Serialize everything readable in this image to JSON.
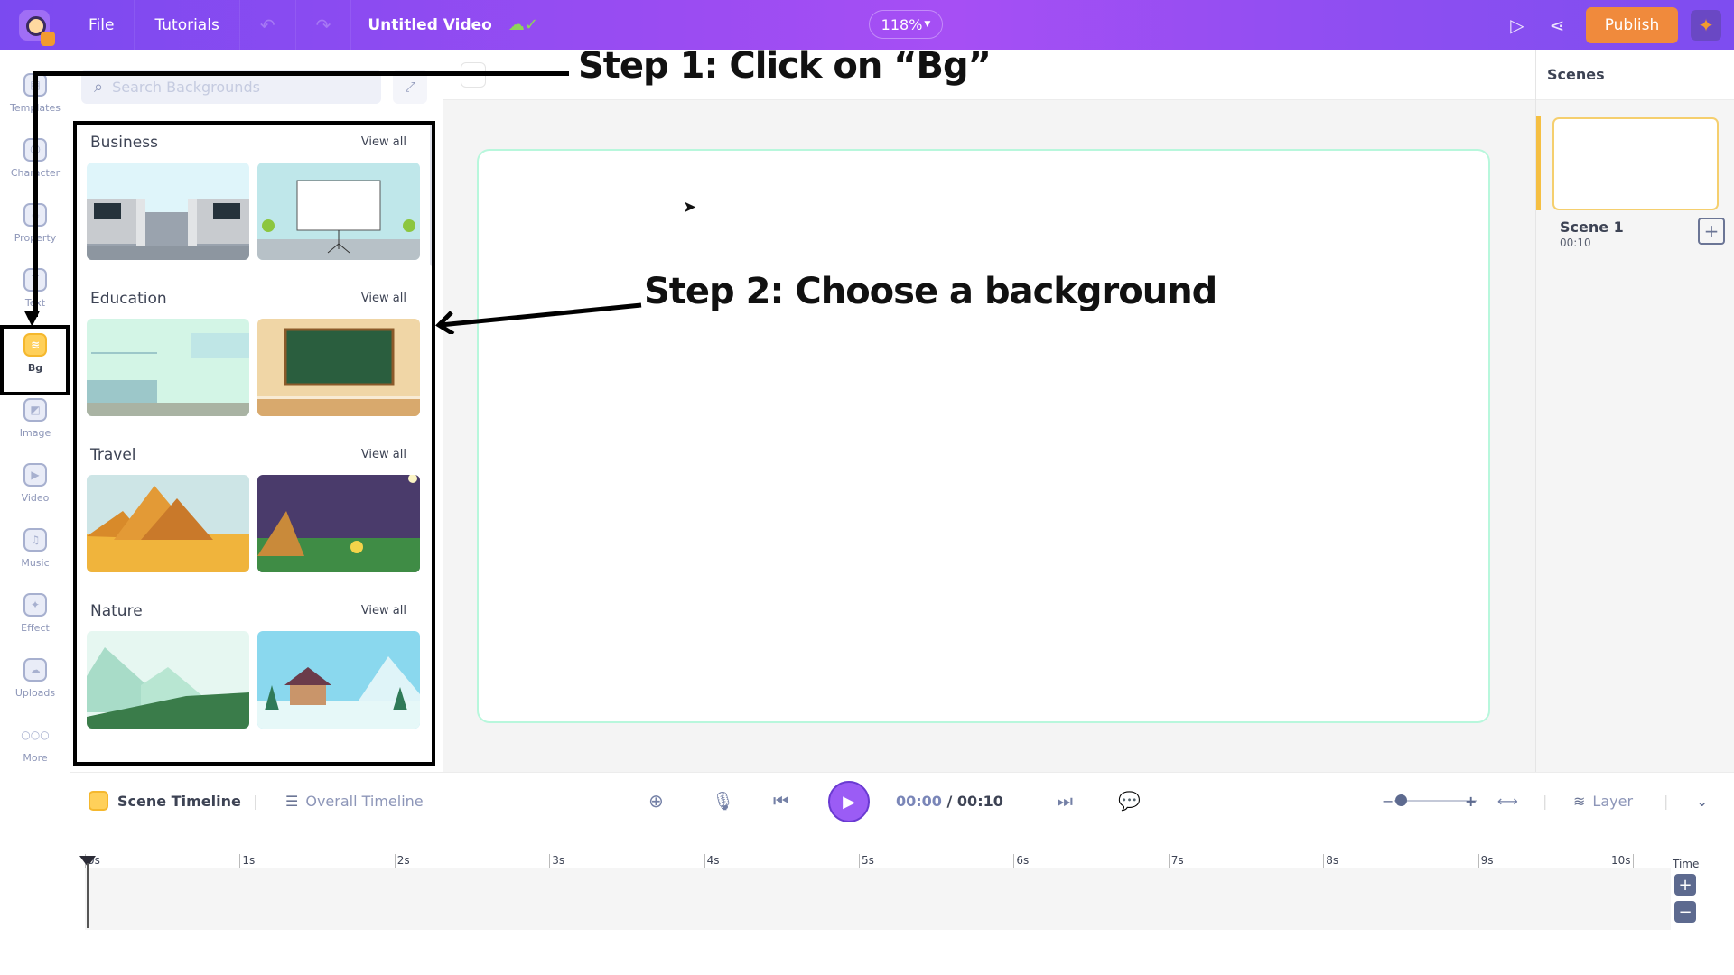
{
  "topbar": {
    "menu": [
      "File",
      "Tutorials"
    ],
    "undo_icon": "undo-icon",
    "redo_icon": "redo-icon",
    "title": "Untitled Video",
    "save_status_icon": "cloud-check-icon",
    "zoom": "118%",
    "preview_icon": "play-outline-icon",
    "share_icon": "share-icon",
    "publish_label": "Publish"
  },
  "sidebar": {
    "items": [
      {
        "label": "Templates",
        "icon": "templates-icon",
        "glyph": "▦"
      },
      {
        "label": "Character",
        "icon": "character-icon",
        "glyph": "☺"
      },
      {
        "label": "Property",
        "icon": "property-icon",
        "glyph": "☕"
      },
      {
        "label": "Text",
        "icon": "text-icon",
        "glyph": "T"
      },
      {
        "label": "Bg",
        "icon": "background-icon",
        "glyph": "≋",
        "active": true
      },
      {
        "label": "Image",
        "icon": "image-icon",
        "glyph": "◩"
      },
      {
        "label": "Video",
        "icon": "video-icon",
        "glyph": "▶"
      },
      {
        "label": "Music",
        "icon": "music-icon",
        "glyph": "♫"
      },
      {
        "label": "Effect",
        "icon": "effect-icon",
        "glyph": "✦"
      },
      {
        "label": "Uploads",
        "icon": "upload-cloud-icon",
        "glyph": "☁"
      },
      {
        "label": "More",
        "icon": "more-icon",
        "glyph": "○○○"
      }
    ]
  },
  "panel": {
    "search_placeholder": "Search Backgrounds",
    "categories": [
      {
        "title": "Business",
        "view_all": "View all"
      },
      {
        "title": "Education",
        "view_all": "View all"
      },
      {
        "title": "Travel",
        "view_all": "View all"
      },
      {
        "title": "Nature",
        "view_all": "View all"
      }
    ]
  },
  "scenes": {
    "header": "Scenes",
    "items": [
      {
        "name": "Scene 1",
        "duration": "00:10"
      }
    ]
  },
  "timeline": {
    "scene_tab": "Scene Timeline",
    "overall_tab": "Overall Timeline",
    "current_time": "00:00",
    "separator": " / ",
    "total_time": "00:10",
    "layer_label": "Layer",
    "time_label": "Time",
    "ticks": [
      "0s",
      "1s",
      "2s",
      "3s",
      "4s",
      "5s",
      "6s",
      "7s",
      "8s",
      "9s",
      "10s"
    ]
  },
  "annotations": {
    "step1": "Step 1: Click on “Bg”",
    "step2": "Step 2: Choose a background"
  },
  "colors": {
    "brand_gradient_start": "#7b4af0",
    "brand_gradient_mid": "#a64ff4",
    "publish": "#f08a3c",
    "active_accent": "#f5b82e",
    "stage_border": "#b8f7dc",
    "play_button": "#9b5cf5"
  }
}
